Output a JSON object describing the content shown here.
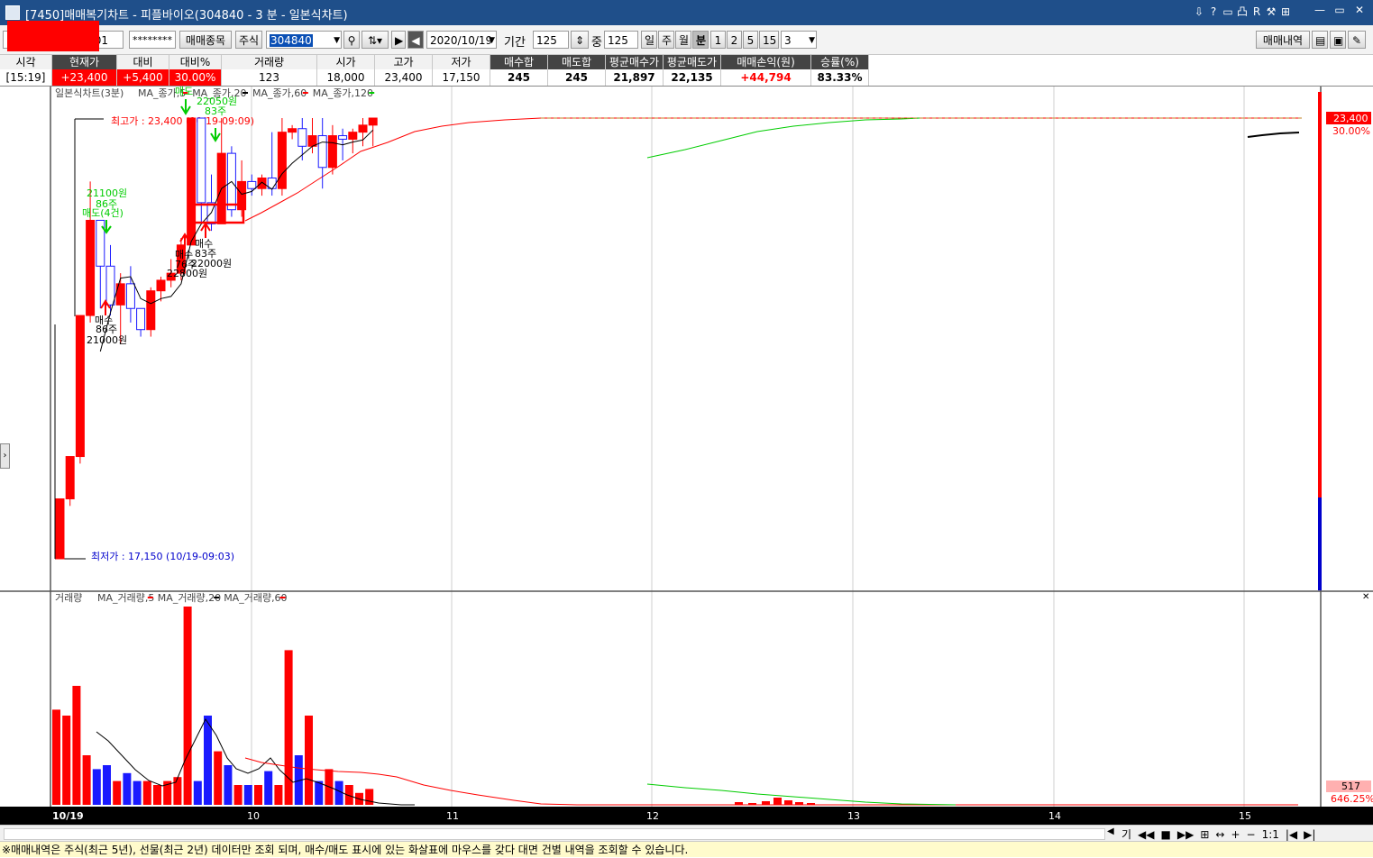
{
  "window": {
    "title": "[7450]매매복기차트 - 피플바이오(304840 - 3 분 - 일본식차트)",
    "title_icons": [
      "restore-pin-icon",
      "help-icon",
      "layout-icon",
      "layout-split-icon",
      "R",
      "tools-icon",
      "window-arrange-icon"
    ],
    "title_icon_labels": [
      "⇩",
      "?",
      "▭",
      "凸",
      "R",
      "⚒",
      "⊞"
    ],
    "min_label": "—",
    "max_label": "▭",
    "close_label": "✕"
  },
  "toolbar": {
    "account_suffix": "01",
    "password_mask": "********",
    "trade_stock_button": "매매종목",
    "market_type": "주식",
    "stock_code": "304840",
    "date": "2020/10/19",
    "period_label": "기간",
    "period_value": "125",
    "count_label": "중",
    "count_value": "125",
    "period_day": "일",
    "period_week": "주",
    "period_month": "월",
    "period_minute": "분",
    "minute_options": [
      "1",
      "2",
      "5",
      "15"
    ],
    "minute_selected": "3",
    "trade_history_button": "매매내역"
  },
  "info": {
    "headers": [
      "시각",
      "현재가",
      "대비",
      "대비%",
      "거래량",
      "시가",
      "고가",
      "저가",
      "매수합",
      "매도합",
      "평균매수가",
      "평균매도가",
      "매매손익(원)",
      "승률(%)"
    ],
    "values": [
      "[15:19]",
      "+23,400",
      "+5,400",
      "30.00%",
      "123",
      "18,000",
      "23,400",
      "17,150",
      "245",
      "245",
      "21,897",
      "22,135",
      "+44,794",
      "83.33%"
    ]
  },
  "price_panel": {
    "legend_title": "일본식차트(3분)",
    "legend_items": [
      {
        "label": "MA_종가,5",
        "color": "#ff0000"
      },
      {
        "label": "MA_종가,20",
        "color": "#000000"
      },
      {
        "label": "MA_종가,60",
        "color": "#ff0000"
      },
      {
        "label": "MA_종가,120",
        "color": "#00cc00"
      }
    ],
    "high_label": "최고가 : 23,400 (10/19-09:09)",
    "low_label": "최저가 : 17,150 (10/19-09:03)",
    "right_price": "23,400",
    "right_pct": "30.00%",
    "annotations": [
      {
        "type": "sell",
        "lines": [
          "21100원",
          "86주",
          "매도(4건)"
        ]
      },
      {
        "type": "sell",
        "lines": [
          "매도",
          "22050원",
          "83주"
        ]
      },
      {
        "type": "buy",
        "lines": [
          "매수",
          "86주",
          "21000원"
        ]
      },
      {
        "type": "buy",
        "lines": [
          "매수",
          "76주",
          "22800원"
        ]
      },
      {
        "type": "buy",
        "lines": [
          "매수",
          "83주",
          "22000원"
        ]
      }
    ]
  },
  "volume_panel": {
    "legend_title": "거래량",
    "legend_items": [
      {
        "label": "MA_거래량,5",
        "color": "#ff0000"
      },
      {
        "label": "MA_거래량,20",
        "color": "#000000"
      },
      {
        "label": "MA_거래량,60",
        "color": "#ff0000"
      }
    ],
    "right_value": "517",
    "right_pct": "646.25%"
  },
  "x_axis": {
    "labels": [
      "10/19",
      "10",
      "11",
      "12",
      "13",
      "14",
      "15"
    ]
  },
  "scroll_controls": [
    "기",
    "◀◀",
    "■",
    "▶▶",
    "⊞",
    "↔",
    "+",
    "−",
    "1:1",
    "|◀",
    "▶|"
  ],
  "status_text": "※매매내역은 주식(최근 5년), 선물(최근 2년) 데이터만 조회 되며, 매수/매도 표시에 있는 화살표에 마우스를 갖다 대면 건별 내역을 조회할 수 있습니다.",
  "chart_data": {
    "type": "candlestick",
    "interval": "3분",
    "date": "2020/10/19",
    "candles": [
      {
        "open": 17150,
        "high": 18000,
        "low": 17150,
        "close": 18000,
        "volume_level": 0.48
      },
      {
        "open": 18000,
        "high": 18600,
        "low": 17900,
        "close": 18600,
        "volume_level": 0.45
      },
      {
        "open": 18600,
        "high": 20600,
        "low": 18500,
        "close": 20600,
        "volume_level": 0.6
      },
      {
        "open": 20600,
        "high": 22500,
        "low": 20500,
        "close": 21950,
        "volume_level": 0.25
      },
      {
        "open": 21950,
        "high": 21950,
        "low": 20700,
        "close": 21300,
        "volume_level": 0.18
      },
      {
        "open": 21300,
        "high": 21600,
        "low": 20600,
        "close": 20750,
        "volume_level": 0.2
      },
      {
        "open": 20750,
        "high": 21200,
        "low": 20200,
        "close": 21050,
        "volume_level": 0.12
      },
      {
        "open": 21050,
        "high": 21300,
        "low": 20500,
        "close": 20700,
        "volume_level": 0.16
      },
      {
        "open": 20700,
        "high": 20700,
        "low": 20300,
        "close": 20400,
        "volume_level": 0.12
      },
      {
        "open": 20400,
        "high": 21000,
        "low": 20300,
        "close": 20950,
        "volume_level": 0.12
      },
      {
        "open": 20950,
        "high": 21150,
        "low": 20800,
        "close": 21100,
        "volume_level": 0.1
      },
      {
        "open": 21100,
        "high": 21400,
        "low": 21000,
        "close": 21200,
        "volume_level": 0.12
      },
      {
        "open": 21200,
        "high": 21700,
        "low": 21100,
        "close": 21600,
        "volume_level": 0.14
      },
      {
        "open": 21600,
        "high": 23400,
        "low": 21600,
        "close": 23400,
        "volume_level": 1.0
      },
      {
        "open": 23400,
        "high": 23400,
        "low": 21900,
        "close": 22200,
        "volume_level": 0.12
      },
      {
        "open": 22200,
        "high": 22600,
        "low": 21800,
        "close": 21900,
        "volume_level": 0.45
      },
      {
        "open": 21900,
        "high": 23400,
        "low": 21900,
        "close": 22900,
        "volume_level": 0.27
      },
      {
        "open": 22900,
        "high": 23000,
        "low": 22000,
        "close": 22100,
        "volume_level": 0.2
      },
      {
        "open": 22100,
        "high": 22800,
        "low": 22000,
        "close": 22500,
        "volume_level": 0.1
      },
      {
        "open": 22500,
        "high": 22600,
        "low": 22300,
        "close": 22400,
        "volume_level": 0.1
      },
      {
        "open": 22400,
        "high": 22600,
        "low": 22300,
        "close": 22550,
        "volume_level": 0.1
      },
      {
        "open": 22550,
        "high": 23200,
        "low": 22300,
        "close": 22400,
        "volume_level": 0.17
      },
      {
        "open": 22400,
        "high": 23400,
        "low": 22300,
        "close": 23200,
        "volume_level": 0.1
      },
      {
        "open": 23200,
        "high": 23300,
        "low": 23100,
        "close": 23250,
        "volume_level": 0.78
      },
      {
        "open": 23250,
        "high": 23400,
        "low": 22800,
        "close": 23000,
        "volume_level": 0.25
      },
      {
        "open": 23000,
        "high": 23400,
        "low": 22900,
        "close": 23150,
        "volume_level": 0.45
      },
      {
        "open": 23150,
        "high": 23400,
        "low": 22400,
        "close": 22700,
        "volume_level": 0.12
      },
      {
        "open": 22700,
        "high": 23300,
        "low": 22600,
        "close": 23150,
        "volume_level": 0.18
      },
      {
        "open": 23150,
        "high": 23250,
        "low": 22800,
        "close": 23100,
        "volume_level": 0.12
      },
      {
        "open": 23100,
        "high": 23250,
        "low": 22900,
        "close": 23200,
        "volume_level": 0.1
      },
      {
        "open": 23200,
        "high": 23400,
        "low": 23000,
        "close": 23300,
        "volume_level": 0.06
      },
      {
        "open": 23300,
        "high": 23400,
        "low": 23000,
        "close": 23400,
        "volume_level": 0.08
      }
    ]
  }
}
